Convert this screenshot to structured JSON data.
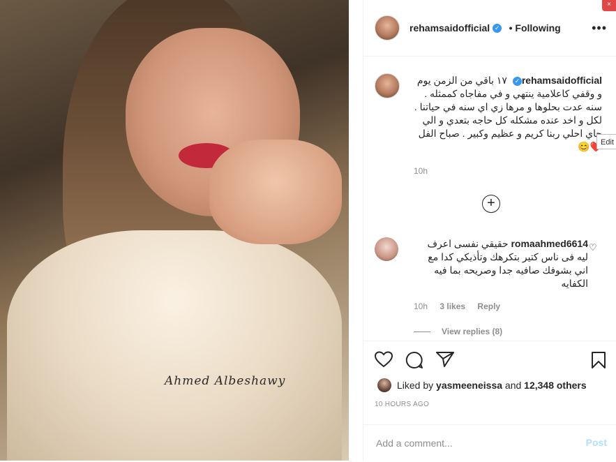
{
  "post": {
    "author": "rehamsaidofficial",
    "follow_state": "Following",
    "more_icon": "•••",
    "photo_signature": "Ahmed Albeshawy"
  },
  "caption": {
    "username": "rehamsaidofficial",
    "text": "١٧ باقي من الزمن يوم و وقفي كاعلامية ينتهي و في مفاجاه كممثله . سنه عدت بحلوها و مرها زي اي سنه في حياتنا . لكل و اخد عنده مشكله كل حاجه بتعدي و الي جاي احلي ربنا كريم و عظيم وكبير . صباح الفل",
    "emoji": "❤️😊",
    "time": "10h"
  },
  "load_more_icon": "+",
  "comment": {
    "username": "romaahmed6614",
    "text": "حقيقي نفسى اعرف ليه فى ناس كتير بتكرهك وتأذيكي كدا مع اني بشوفك صافيه جدا وصريحه بما فيه الكفايه",
    "time": "10h",
    "likes": "3 likes",
    "reply": "Reply",
    "view_replies": "View replies (8)"
  },
  "likes": {
    "prefix": "Liked by",
    "first_user": "yasmeeneissa",
    "joiner": "and",
    "others": "12,348 others"
  },
  "timestamp": "10 HOURS AGO",
  "add_comment": {
    "placeholder": "Add a comment...",
    "post_label": "Post"
  },
  "overlay": {
    "edit_label": "Edit",
    "close_label": "×"
  },
  "colors": {
    "verified": "#3897f0",
    "post_disabled": "#b2dffc",
    "muted": "#8e8e8e"
  }
}
